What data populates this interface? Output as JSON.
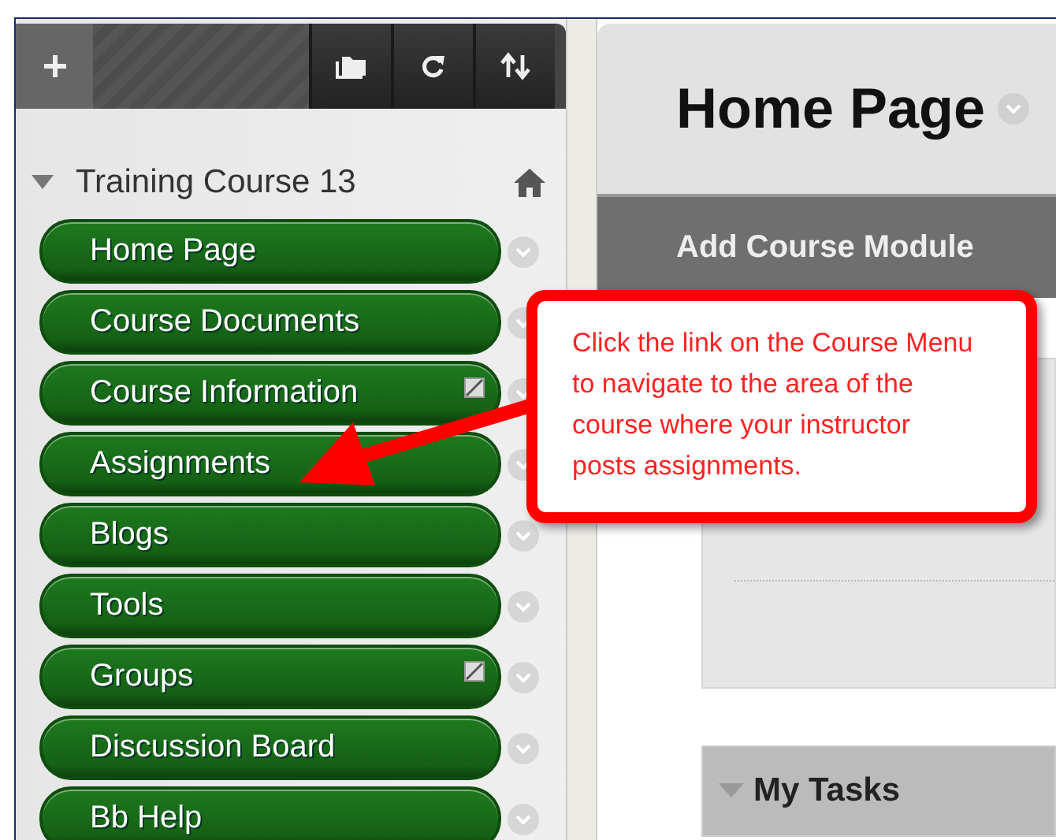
{
  "course_menu": {
    "title": "Training Course 13",
    "items": [
      {
        "label": "Home Page",
        "hidden_icon": false
      },
      {
        "label": "Course Documents",
        "hidden_icon": false
      },
      {
        "label": "Course Information",
        "hidden_icon": true
      },
      {
        "label": "Assignments",
        "hidden_icon": false
      },
      {
        "label": "Blogs",
        "hidden_icon": false
      },
      {
        "label": "Tools",
        "hidden_icon": false
      },
      {
        "label": "Groups",
        "hidden_icon": true
      },
      {
        "label": "Discussion Board",
        "hidden_icon": false
      },
      {
        "label": "Bb Help",
        "hidden_icon": false
      }
    ]
  },
  "page_title": "Home Page",
  "action_bar": {
    "button": "Add Course Module"
  },
  "modules": [
    {
      "title": "My Tasks"
    }
  ],
  "callout": {
    "text": "Click the link on the Course Menu to navigate to the area of the course where your instructor posts assignments."
  }
}
